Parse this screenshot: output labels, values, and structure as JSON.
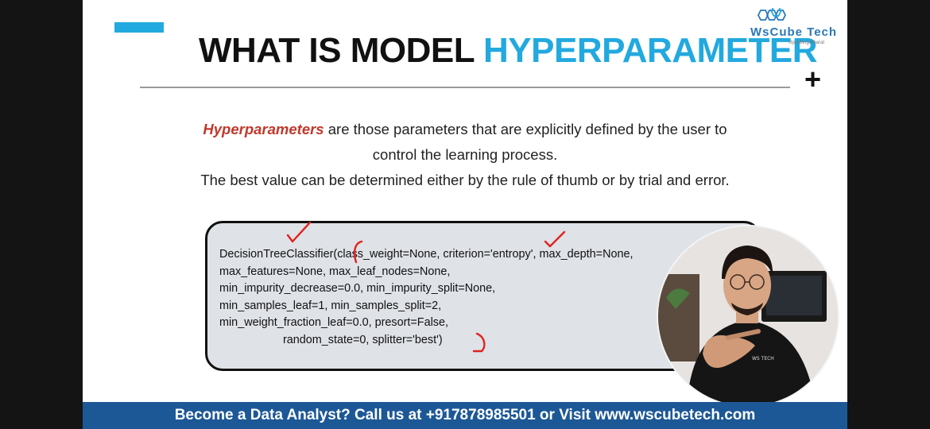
{
  "slide": {
    "title_main": "WHAT IS MODEL",
    "title_highlight": "HYPERPARAMETER",
    "logo_brand": "WsCube Tech",
    "logo_tagline": "Upskilling Bharat",
    "definition_term": "Hyperparameters",
    "definition_rest": " are those parameters that are explicitly defined by the user to",
    "definition_line2": "control the learning process.",
    "definition_line3": "The best value can be determined either by the rule of thumb or by trial and error.",
    "code_lines": [
      "DecisionTreeClassifier(class_weight=None, criterion='entropy', max_depth=None,",
      "max_features=None, max_leaf_nodes=None,",
      "min_impurity_decrease=0.0, min_impurity_split=None,",
      "min_samples_leaf=1, min_samples_split=2,",
      "min_weight_fraction_leaf=0.0, presort=False,",
      "                    random_state=0, splitter='best')"
    ]
  },
  "banner": {
    "text": "Become a Data Analyst? Call us at +917878985501 or Visit www.wscubetech.com"
  },
  "colors": {
    "accent": "#22a9df",
    "term_red": "#c0392b",
    "annotation_red": "#e0221e",
    "banner_blue": "#1d5896",
    "logo_blue": "#2a78b8"
  },
  "icons": [
    "plus-icon",
    "hexagon-logo-icon",
    "presenter-video"
  ]
}
